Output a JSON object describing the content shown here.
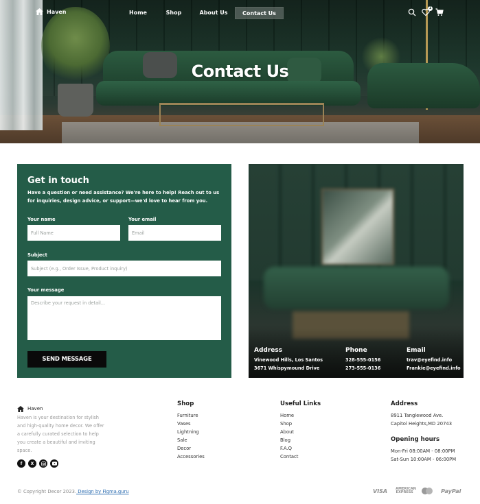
{
  "header": {
    "brand": "Haven",
    "nav": [
      "Home",
      "Shop",
      "About Us",
      "Contact Us"
    ],
    "active_nav": "Contact Us",
    "wishlist_count": "1",
    "icons": [
      "search-icon",
      "heart-icon",
      "cart-icon"
    ]
  },
  "hero": {
    "title": "Contact Us"
  },
  "form": {
    "title": "Get in touch",
    "description": "Have a question or need assistance? We're here to help! Reach out to us for inquiries, design advice, or support—we'd love to hear from you.",
    "name_label": "Your name",
    "name_placeholder": "Full Name",
    "email_label": "Your email",
    "email_placeholder": "Email",
    "subject_label": "Subject",
    "subject_placeholder": "Subject (e.g., Order Issue, Product inquiry)",
    "message_label": "Your message",
    "message_placeholder": "Describe your request in detail...",
    "submit_label": "SEND MESSAGE",
    "bg_color": "#245c48"
  },
  "contact_info": {
    "address": {
      "heading": "Address",
      "lines": [
        "Vinewood Hills, Los Santos",
        "3671 Whispymound Drive"
      ]
    },
    "phone": {
      "heading": "Phone",
      "lines": [
        "328-555-0156",
        "273-555-0136"
      ]
    },
    "email": {
      "heading": "Email",
      "lines": [
        "trav@eyefind.info",
        "Frankie@eyefind.info"
      ]
    }
  },
  "footer": {
    "brand": "Haven",
    "about": "Haven is your destination for stylish and high-quality home decor. We offer a carefully curated selection to help you create a beautiful and inviting space.",
    "socials": [
      "facebook-icon",
      "x-icon",
      "instagram-icon",
      "youtube-icon"
    ],
    "shop": {
      "heading": "Shop",
      "items": [
        "Furniture",
        "Vases",
        "Lightning",
        "Sale",
        "Decor",
        "Accessories"
      ]
    },
    "links": {
      "heading": "Useful Links",
      "items": [
        "Home",
        "Shop",
        "About",
        "Blog",
        "F.A.Q",
        "Contact"
      ]
    },
    "address": {
      "heading": "Address",
      "lines": [
        "8911 Tanglewood Ave.",
        "Capitol Heights,MD 20743"
      ]
    },
    "hours": {
      "heading": "Opening hours",
      "lines": [
        "Mon-Fri 08:00AM - 08:00PM",
        "Sat-Sun 10:00AM - 06:00PM"
      ]
    },
    "copyright_text": "© Copyright Decor 2023.",
    "credit_link": " Design by Figma.guru",
    "payments": [
      "VISA",
      "AMERICAN EXPRESS",
      "mastercard",
      "PayPal"
    ]
  }
}
